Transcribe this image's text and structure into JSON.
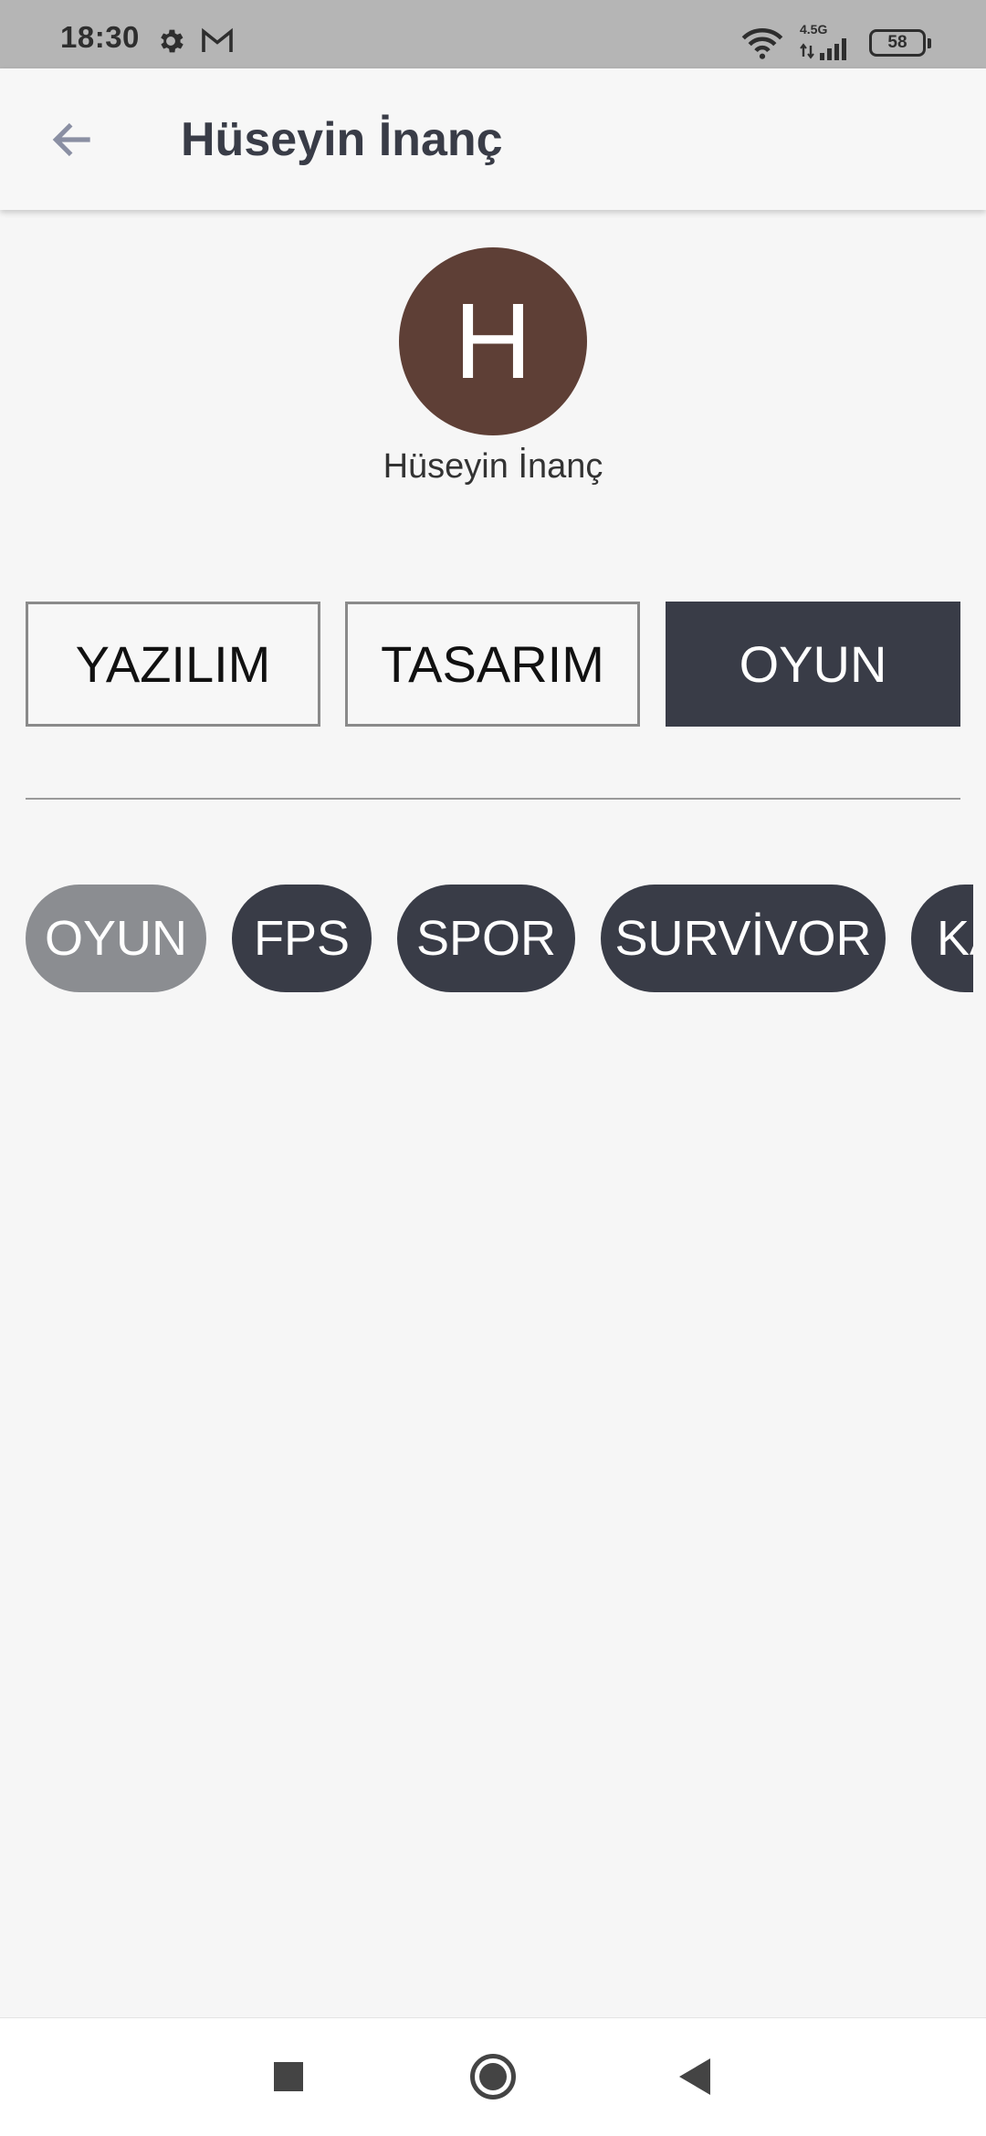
{
  "status_bar": {
    "time": "18:30",
    "network_label": "4.5G",
    "battery": "58",
    "icons": [
      "gear-icon",
      "gmail-icon",
      "wifi-icon",
      "signal-icon",
      "battery-icon"
    ]
  },
  "app_bar": {
    "title": "Hüseyin İnanç",
    "back_icon": "arrow-left-icon"
  },
  "profile": {
    "avatar_letter": "H",
    "avatar_color": "#5e3f36",
    "name": "Hüseyin İnanç"
  },
  "tabs": [
    {
      "label": "YAZILIM",
      "active": false
    },
    {
      "label": "TASARIM",
      "active": false
    },
    {
      "label": "OYUN",
      "active": true
    }
  ],
  "chips": [
    {
      "label": "OYUN",
      "selected": true
    },
    {
      "label": "FPS",
      "selected": false
    },
    {
      "label": "SPOR",
      "selected": false
    },
    {
      "label": "SURVİVOR",
      "selected": false
    },
    {
      "label": "KA",
      "selected": false
    }
  ],
  "colors": {
    "primary_dark": "#393c47",
    "chip_selected": "#8b8d91",
    "background": "#f6f6f6"
  },
  "nav_bar": {
    "icons": [
      "recents-square-icon",
      "home-circle-icon",
      "back-triangle-icon"
    ]
  }
}
